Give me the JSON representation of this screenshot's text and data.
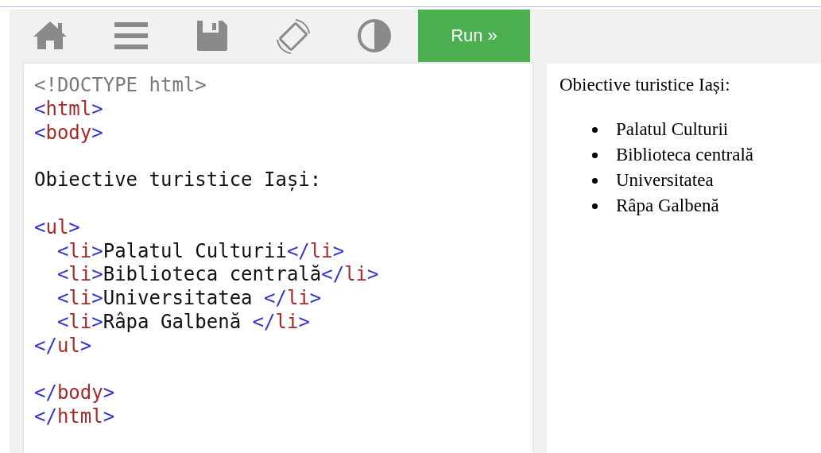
{
  "toolbar": {
    "run_button": {
      "label": "Run »"
    }
  },
  "editor": {
    "lines": [
      {
        "kind": "code",
        "tokens": [
          {
            "kind": "doctype",
            "text": "<!DOCTYPE html>"
          }
        ]
      },
      {
        "kind": "code",
        "tokens": [
          {
            "kind": "punct",
            "text": "<"
          },
          {
            "kind": "name",
            "text": "html"
          },
          {
            "kind": "punct",
            "text": ">"
          }
        ]
      },
      {
        "kind": "code",
        "tokens": [
          {
            "kind": "punct",
            "text": "<"
          },
          {
            "kind": "name",
            "text": "body"
          },
          {
            "kind": "punct",
            "text": ">"
          }
        ]
      },
      {
        "kind": "blank"
      },
      {
        "kind": "code",
        "tokens": [
          {
            "kind": "text",
            "text": "Obiective turistice Iași:"
          }
        ]
      },
      {
        "kind": "blank"
      },
      {
        "kind": "code",
        "tokens": [
          {
            "kind": "punct",
            "text": "<"
          },
          {
            "kind": "name",
            "text": "ul"
          },
          {
            "kind": "punct",
            "text": ">"
          }
        ]
      },
      {
        "kind": "code",
        "tokens": [
          {
            "kind": "punct",
            "text": "  <"
          },
          {
            "kind": "name",
            "text": "li"
          },
          {
            "kind": "punct",
            "text": ">"
          },
          {
            "kind": "text",
            "text": "Palatul Culturii"
          },
          {
            "kind": "punct",
            "text": "</"
          },
          {
            "kind": "name",
            "text": "li"
          },
          {
            "kind": "punct",
            "text": ">"
          }
        ]
      },
      {
        "kind": "code",
        "tokens": [
          {
            "kind": "punct",
            "text": "  <"
          },
          {
            "kind": "name",
            "text": "li"
          },
          {
            "kind": "punct",
            "text": ">"
          },
          {
            "kind": "text",
            "text": "Biblioteca centrală"
          },
          {
            "kind": "punct",
            "text": "</"
          },
          {
            "kind": "name",
            "text": "li"
          },
          {
            "kind": "punct",
            "text": ">"
          }
        ]
      },
      {
        "kind": "code",
        "tokens": [
          {
            "kind": "punct",
            "text": "  <"
          },
          {
            "kind": "name",
            "text": "li"
          },
          {
            "kind": "punct",
            "text": ">"
          },
          {
            "kind": "text",
            "text": "Universitatea "
          },
          {
            "kind": "punct",
            "text": "</"
          },
          {
            "kind": "name",
            "text": "li"
          },
          {
            "kind": "punct",
            "text": ">"
          }
        ]
      },
      {
        "kind": "code",
        "tokens": [
          {
            "kind": "punct",
            "text": "  <"
          },
          {
            "kind": "name",
            "text": "li"
          },
          {
            "kind": "punct",
            "text": ">"
          },
          {
            "kind": "text",
            "text": "Râpa Galbenă "
          },
          {
            "kind": "punct",
            "text": "</"
          },
          {
            "kind": "name",
            "text": "li"
          },
          {
            "kind": "punct",
            "text": ">"
          }
        ]
      },
      {
        "kind": "code",
        "tokens": [
          {
            "kind": "punct",
            "text": "</"
          },
          {
            "kind": "name",
            "text": "ul"
          },
          {
            "kind": "punct",
            "text": ">"
          }
        ]
      },
      {
        "kind": "blank"
      },
      {
        "kind": "code",
        "tokens": [
          {
            "kind": "punct",
            "text": "</"
          },
          {
            "kind": "name",
            "text": "body"
          },
          {
            "kind": "punct",
            "text": ">"
          }
        ]
      },
      {
        "kind": "code",
        "tokens": [
          {
            "kind": "punct",
            "text": "</"
          },
          {
            "kind": "name",
            "text": "html"
          },
          {
            "kind": "punct",
            "text": ">"
          }
        ]
      }
    ]
  },
  "preview": {
    "heading": "Obiective turistice Iași:",
    "items": [
      "Palatul Culturii",
      "Biblioteca centrală",
      "Universitatea",
      "Râpa Galbenă"
    ]
  }
}
